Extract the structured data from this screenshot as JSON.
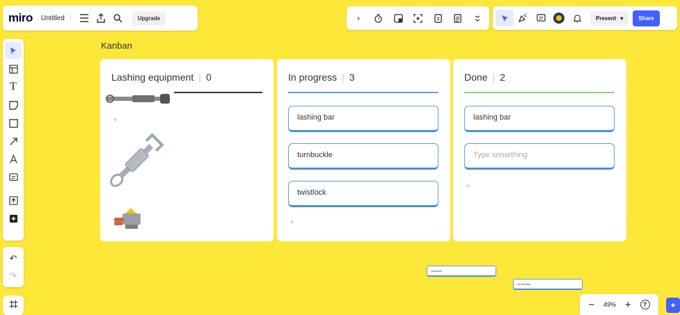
{
  "topbar": {
    "logo": "miro",
    "board_name": "Untitled",
    "upgrade_label": "Upgrade",
    "present_label": "Present",
    "share_label": "Share"
  },
  "icons": {
    "menu": "menu-icon",
    "export": "export-icon",
    "search": "search-icon",
    "expand": "chevron-right-icon",
    "timer": "timer-icon",
    "frame": "frame-icon",
    "focus": "focus-icon",
    "vote": "vote-icon",
    "notes": "notes-icon",
    "more": "more-icon",
    "cursor": "cursor-icon",
    "reactions": "reactions-icon",
    "comments": "comments-icon",
    "avatar": "avatar-icon",
    "bell": "bell-icon"
  },
  "zoom": {
    "level": "49%"
  },
  "kanban": {
    "title": "Kanban",
    "columns": [
      {
        "name": "Lashing equipment",
        "count": "0",
        "line_color": "#333333",
        "cards": []
      },
      {
        "name": "In progress",
        "count": "3",
        "line_color": "#5f9be8",
        "cards": [
          "lashing bar",
          "turnbuckle",
          "twistlock"
        ]
      },
      {
        "name": "Done",
        "count": "2",
        "line_color": "#8fd16a",
        "cards": [
          "lashing bar"
        ],
        "placeholder": "Type something"
      }
    ]
  },
  "floating": {
    "card1": "twistlock",
    "card2": "turnbuckle"
  },
  "colors": {
    "canvas": "#fde83a",
    "accent": "#4262ff",
    "card_border": "#5f9be8"
  }
}
